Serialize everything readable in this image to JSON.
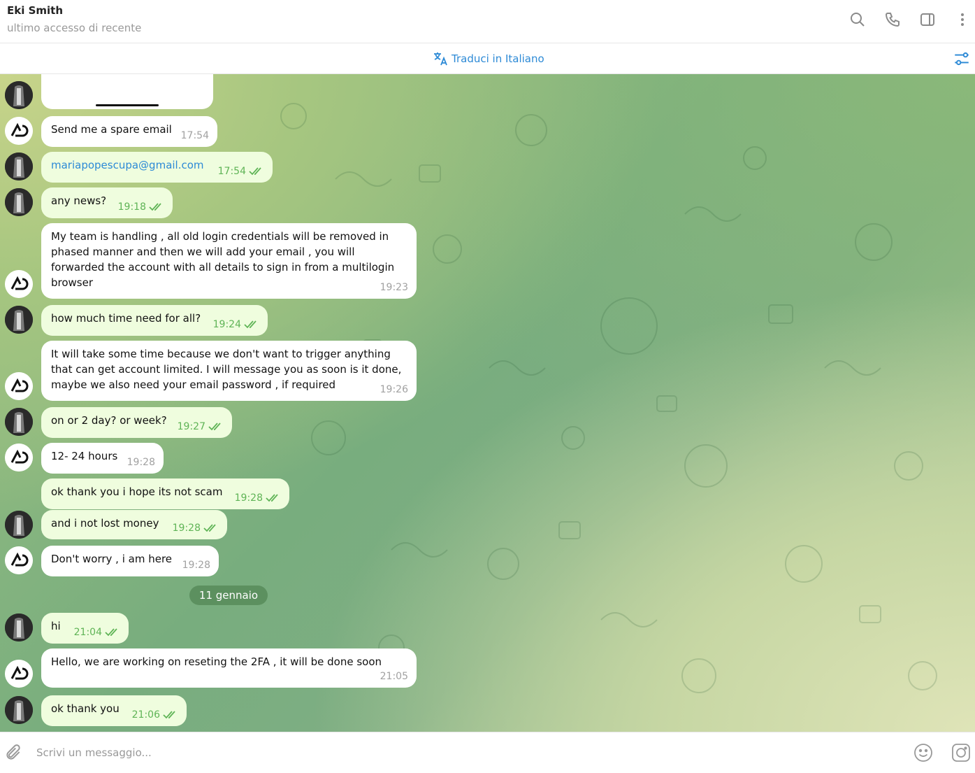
{
  "header": {
    "name": "Eki Smith",
    "status": "ultimo accesso di recente",
    "icons": [
      "search-icon",
      "phone-icon",
      "sidebar-icon",
      "more-vertical-icon"
    ]
  },
  "translate_bar": {
    "label": "Traduci in Italiano",
    "icon": "translate-icon",
    "settings_icon": "sliders-icon"
  },
  "date_separator": "11 gennaio",
  "messages": [
    {
      "text": "Send me a spare email",
      "time": "17:54",
      "dir": "in"
    },
    {
      "text": "mariapopescupa@gmail.com",
      "time": "17:54",
      "dir": "out",
      "link": true
    },
    {
      "text": "any news?",
      "time": "19:18",
      "dir": "out"
    },
    {
      "text": "My team is handling , all old login credentials will be removed in phased manner and then we will add your email , you will forwarded the account with all details to sign in from a multilogin browser",
      "time": "19:23",
      "dir": "in"
    },
    {
      "text": "how much time need for all?",
      "time": "19:24",
      "dir": "out"
    },
    {
      "text": "It will take some time because we don't want to trigger anything that can get account limited. I will message you as soon is it done, maybe we also need your email password , if required",
      "time": "19:26",
      "dir": "in"
    },
    {
      "text": "on or 2 day? or week?",
      "time": "19:27",
      "dir": "out"
    },
    {
      "text": "12- 24 hours",
      "time": "19:28",
      "dir": "in"
    },
    {
      "text": "ok thank you i hope its not scam",
      "time": "19:28",
      "dir": "out"
    },
    {
      "text": "and i not lost money",
      "time": "19:28",
      "dir": "out"
    },
    {
      "text": "Don't worry , i am here",
      "time": "19:28",
      "dir": "in"
    },
    {
      "text": "hi",
      "time": "21:04",
      "dir": "out"
    },
    {
      "text": "Hello,  we are working on reseting the 2FA , it will be done soon",
      "time": "21:05",
      "dir": "in"
    },
    {
      "text": "ok thank you",
      "time": "21:06",
      "dir": "out"
    }
  ],
  "composer": {
    "placeholder": "Scrivi un messaggio...",
    "icons": [
      "attach-icon",
      "emoji-icon",
      "sticker-icon"
    ]
  },
  "colors": {
    "accent": "#2d8ad6",
    "outgoing_bubble": "#effdde",
    "incoming_bubble": "#ffffff",
    "check_color": "#5fb456"
  }
}
